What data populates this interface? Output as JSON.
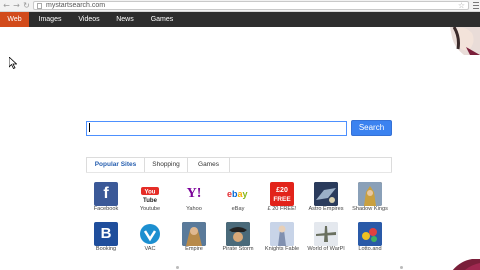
{
  "browser": {
    "url": "mystartsearch.com",
    "back_icon": "back-arrow-icon",
    "forward_icon": "forward-arrow-icon",
    "reload_icon": "reload-icon",
    "bookmark_icon": "star-icon",
    "menu_icon": "menu-icon"
  },
  "topnav": {
    "tabs": [
      {
        "label": "Web",
        "active": true
      },
      {
        "label": "Images",
        "active": false
      },
      {
        "label": "Videos",
        "active": false
      },
      {
        "label": "News",
        "active": false
      },
      {
        "label": "Games",
        "active": false
      }
    ]
  },
  "search": {
    "value": "",
    "button_label": "Search"
  },
  "site_tabs": [
    {
      "label": "Popular Sites",
      "active": true
    },
    {
      "label": "Shopping",
      "active": false
    },
    {
      "label": "Games",
      "active": false
    }
  ],
  "sites": [
    {
      "label": "Facebook",
      "icon": "facebook-icon"
    },
    {
      "label": "Youtube",
      "icon": "youtube-icon"
    },
    {
      "label": "Yahoo",
      "icon": "yahoo-icon"
    },
    {
      "label": "eBay",
      "icon": "ebay-icon"
    },
    {
      "label": "£ 20 FREE!",
      "icon": "promo-icon",
      "tile_text": "£20\nFREE"
    },
    {
      "label": "Astro Empires",
      "icon": "astro-empires-icon"
    },
    {
      "label": "Shadow Kings",
      "icon": "shadow-kings-icon"
    },
    {
      "label": "Booking",
      "icon": "booking-icon"
    },
    {
      "label": "VAC",
      "icon": "vac-icon"
    },
    {
      "label": "Empire",
      "icon": "empire-icon"
    },
    {
      "label": "Pirate Storm",
      "icon": "pirate-storm-icon"
    },
    {
      "label": "Knights Fable",
      "icon": "knights-fable-icon"
    },
    {
      "label": "World of WarPl",
      "icon": "world-of-warplanes-icon"
    },
    {
      "label": "Lotto.and",
      "icon": "lotto-icon"
    }
  ],
  "colors": {
    "nav_bg": "#2d2d2d",
    "nav_active": "#d24b1b",
    "search_button": "#3b82f0",
    "accent_blue": "#2860b0"
  }
}
